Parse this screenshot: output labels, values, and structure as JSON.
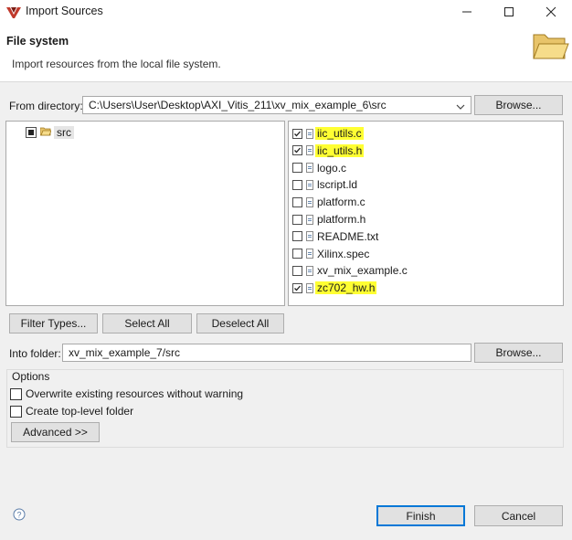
{
  "window": {
    "title": "Import Sources",
    "minimize_icon": "minimize-icon",
    "maximize_icon": "maximize-icon",
    "close_icon": "close-icon"
  },
  "header": {
    "title": "File system",
    "description": "Import resources from the local file system.",
    "icon": "folder-open-icon"
  },
  "from_directory": {
    "label": "From directory:",
    "value": "C:\\Users\\User\\Desktop\\AXI_Vitis_211\\xv_mix_example_6\\src",
    "browse_label": "Browse..."
  },
  "tree": {
    "items": [
      {
        "label": "src",
        "state": "partial"
      }
    ]
  },
  "files": [
    {
      "name": "iic_utils.c",
      "checked": true,
      "highlighted": true
    },
    {
      "name": "iic_utils.h",
      "checked": true,
      "highlighted": true
    },
    {
      "name": "logo.c",
      "checked": false,
      "highlighted": false
    },
    {
      "name": "lscript.ld",
      "checked": false,
      "highlighted": false
    },
    {
      "name": "platform.c",
      "checked": false,
      "highlighted": false
    },
    {
      "name": "platform.h",
      "checked": false,
      "highlighted": false
    },
    {
      "name": "README.txt",
      "checked": false,
      "highlighted": false
    },
    {
      "name": "Xilinx.spec",
      "checked": false,
      "highlighted": false
    },
    {
      "name": "xv_mix_example.c",
      "checked": false,
      "highlighted": false
    },
    {
      "name": "zc702_hw.h",
      "checked": true,
      "highlighted": true
    }
  ],
  "selection_buttons": {
    "filter_types": "Filter Types...",
    "select_all": "Select All",
    "deselect_all": "Deselect All"
  },
  "into_folder": {
    "label": "Into folder:",
    "value": "xv_mix_example_7/src",
    "browse_label": "Browse..."
  },
  "options": {
    "group_label": "Options",
    "overwrite_label": "Overwrite existing resources without warning",
    "overwrite_checked": false,
    "create_top_level_label": "Create top-level folder",
    "create_top_level_checked": false,
    "advanced_label": "Advanced >>"
  },
  "footer": {
    "help_icon": "help-icon",
    "finish_label": "Finish",
    "cancel_label": "Cancel"
  },
  "colors": {
    "highlight": "#ffff33",
    "accent": "#0078d7",
    "dialog_bg": "#f0f0f0"
  }
}
